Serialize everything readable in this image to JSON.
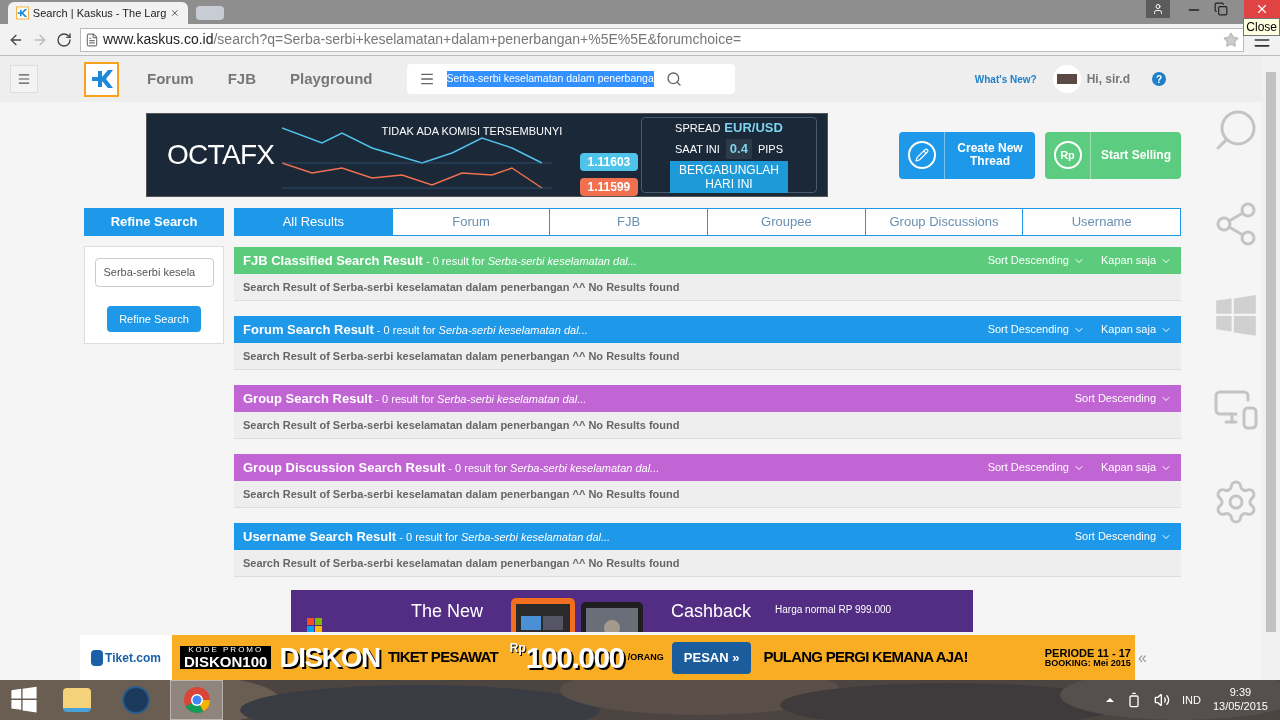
{
  "browser": {
    "tab_title": "Search | Kaskus - The Larg",
    "tooltip": "Close",
    "url_host": "www.kaskus.co.id",
    "url_path": "/search?q=Serba-serbi+keselamatan+dalam+penerbangan+%5E%5E&forumchoice="
  },
  "nav": {
    "items": [
      "Forum",
      "FJB",
      "Playground"
    ],
    "search_value": "Serba-serbi keselamatan dalam penerbanga",
    "whats_new": "What's New?",
    "greeting": "Hi, sir.d",
    "help": "?"
  },
  "ad": {
    "logo": "OCTAFX",
    "headline": "TIDAK ADA KOMISI TERSEMBUNYI",
    "price_high": "1.11603",
    "price_low": "1.11599",
    "spread": "SPREAD",
    "pair": "EUR/USD",
    "now": "SAAT INI",
    "pips_value": "0.4",
    "pips": "PIPS",
    "cta": "BERGABUNGLAH HARI INI"
  },
  "actions": [
    {
      "label": "Create New Thread",
      "kind": "thread",
      "color": "#1e98e8"
    },
    {
      "label": "Start Selling",
      "kind": "sell",
      "icon_text": "Rp",
      "color": "#5ccc80"
    }
  ],
  "refine": {
    "title": "Refine Search",
    "field_value": "Serba-serbi kesela",
    "button": "Refine Search"
  },
  "tabs": [
    {
      "label": "All Results",
      "selected": true
    },
    {
      "label": "Forum",
      "selected": false
    },
    {
      "label": "FJB",
      "selected": false
    },
    {
      "label": "Groupee",
      "selected": false
    },
    {
      "label": "Group Discussions",
      "selected": false
    },
    {
      "label": "Username",
      "selected": false
    }
  ],
  "sections": [
    {
      "title": "**FJB Classified Search Result** - 0 result for *Serba-serbi keselamatan dal...*",
      "color": "#5ccc7c",
      "sort": "Sort Descending",
      "time": "Kapan saja",
      "body": "Search Result of Serba-serbi keselamatan dalam penerbangan ^^ No Results found"
    },
    {
      "title": "**Forum Search Result** - 0 result for *Serba-serbi keselamatan dal...*",
      "color": "#1e98e8",
      "sort": "Sort Descending",
      "time": "Kapan saja",
      "body": "Search Result of Serba-serbi keselamatan dalam penerbangan ^^ No Results found"
    },
    {
      "title": "**Group Search Result** - 0 result for *Serba-serbi keselamatan dal...*",
      "color": "#c164d4",
      "sort": "Sort Descending",
      "body": "Search Result of Serba-serbi keselamatan dalam penerbangan ^^ No Results found"
    },
    {
      "title": "**Group Discussion Search Result** - 0 result for *Serba-serbi keselamatan dal...*",
      "color": "#c164d4",
      "sort": "Sort Descending",
      "time": "Kapan saja",
      "body": "Search Result of Serba-serbi keselamatan dalam penerbangan ^^ No Results found"
    },
    {
      "title": "**Username Search Result** - 0 result for *Serba-serbi keselamatan dal...*",
      "color": "#1e98e8",
      "sort": "Sort Descending",
      "body": "Search Result of Serba-serbi keselamatan dalam penerbangan ^^ No Results found"
    }
  ],
  "bottom_ad": {
    "headline": "The New",
    "cashback": "Cashback",
    "price_note": "Harga normal RP 999.000"
  },
  "promo": {
    "brand": "Tiket.com",
    "code_label": "KODE PROMO",
    "code": "DISKON100",
    "discount": "DISKON",
    "product": "TIKET PESAWAT",
    "currency": "Rp",
    "amount": "100.000",
    "per": "/ORANG",
    "button": "PESAN »",
    "slogan": "PULANG PERGI KEMANA AJA!",
    "period": "PERIODE 11 - 17",
    "booking": "BOOKING: Mei 2015",
    "collapse": "«"
  },
  "taskbar": {
    "language": "IND",
    "time": "9:39",
    "date": "13/05/2015"
  }
}
